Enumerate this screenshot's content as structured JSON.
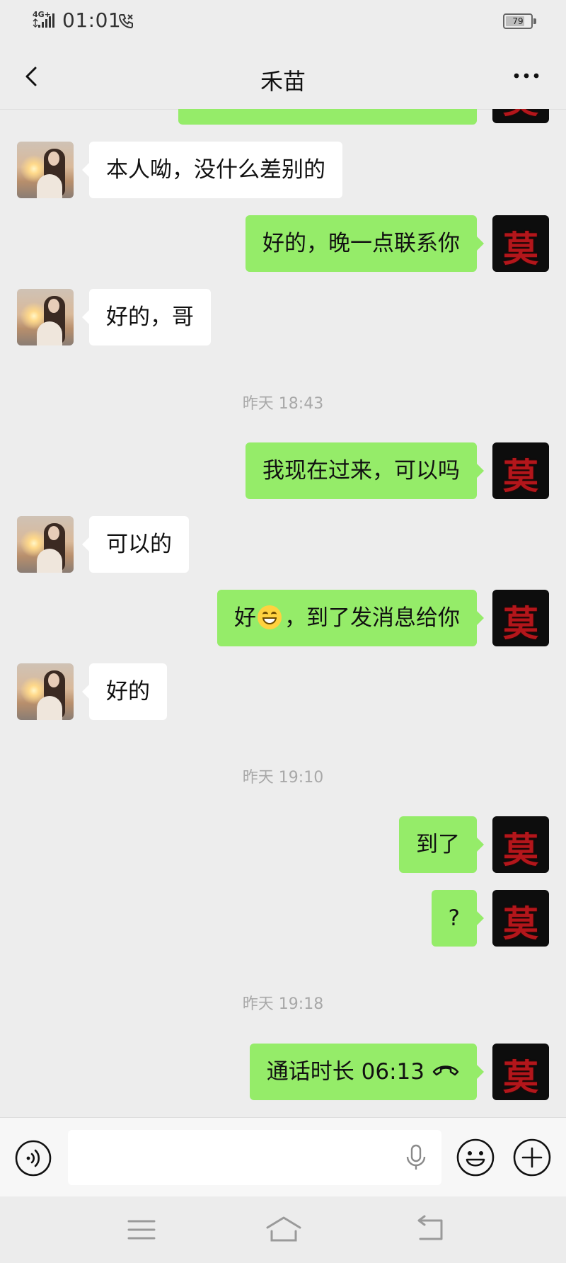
{
  "status_bar": {
    "network": "4G+",
    "time": "01:01",
    "battery": "79",
    "battery_level": 0.79
  },
  "header": {
    "title": "禾苗"
  },
  "messages": [
    {
      "text": "本人呦，没什么差别的"
    },
    {
      "text": "好的，晚一点联系你"
    },
    {
      "text": "好的，哥"
    },
    {
      "text": "昨天 18:43"
    },
    {
      "text": "我现在过来，可以吗"
    },
    {
      "text": "可以的"
    },
    {
      "text_before": "好",
      "emoji": "grinning-face-emoji",
      "text_after": "，到了发消息给你"
    },
    {
      "text": "好的"
    },
    {
      "text": "昨天 19:10"
    },
    {
      "text": "到了"
    },
    {
      "text": "?"
    },
    {
      "text": "昨天 19:18"
    },
    {
      "text": "通话时长 06:13"
    }
  ],
  "avatar_me_glyph": "莫",
  "icons": {
    "back": "chevron-left-icon",
    "more": "more-dots-icon",
    "voice": "voice-mode-icon",
    "mic": "microphone-icon",
    "emoji": "emoji-icon",
    "plus": "plus-icon",
    "call_end": "phone-hangup-icon"
  },
  "colors": {
    "background": "#ededed",
    "bubble_out": "#95ec69",
    "bubble_in": "#ffffff",
    "timestamp": "#a8a8a8"
  },
  "input": {
    "value": ""
  }
}
